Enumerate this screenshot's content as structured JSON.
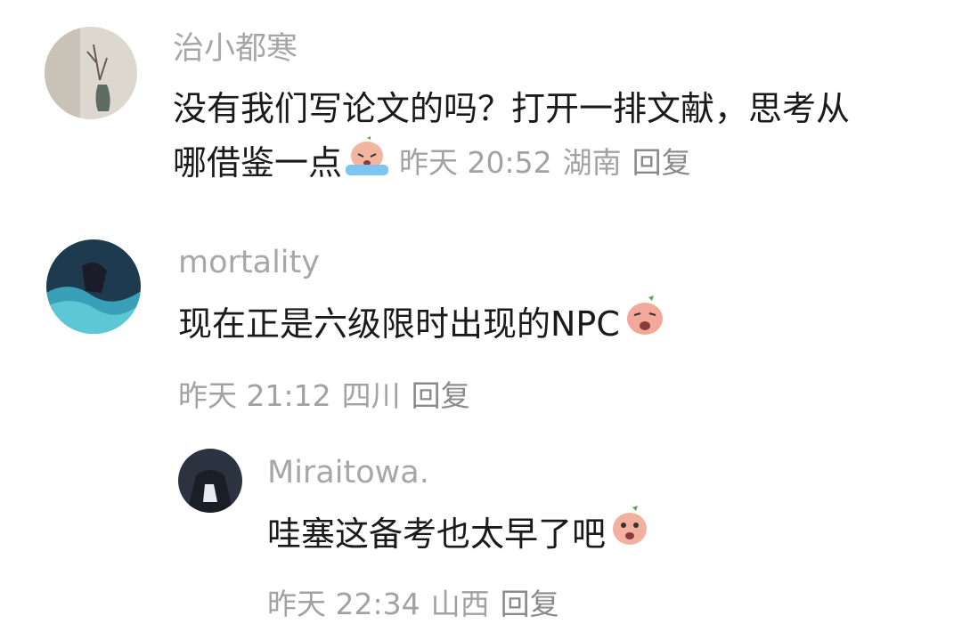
{
  "comments": [
    {
      "username": "治小都寒",
      "text_line1": "没有我们写论文的吗？打开一排文献，思考从",
      "text_line2": "哪借鉴一点",
      "emoji": "crying-peach-emoji",
      "time": "昨天 20:52",
      "location": "湖南",
      "reply": "回复"
    },
    {
      "username": "mortality",
      "text": "现在正是六级限时出现的NPC",
      "emoji": "sad-peach-emoji",
      "time": "昨天 21:12",
      "location": "四川",
      "reply": "回复"
    }
  ],
  "replies": [
    {
      "username": "Miraitowa.",
      "text": "哇塞这备考也太早了吧",
      "emoji": "shocked-peach-emoji",
      "time": "昨天 22:34",
      "location": "山西",
      "reply": "回复"
    }
  ]
}
